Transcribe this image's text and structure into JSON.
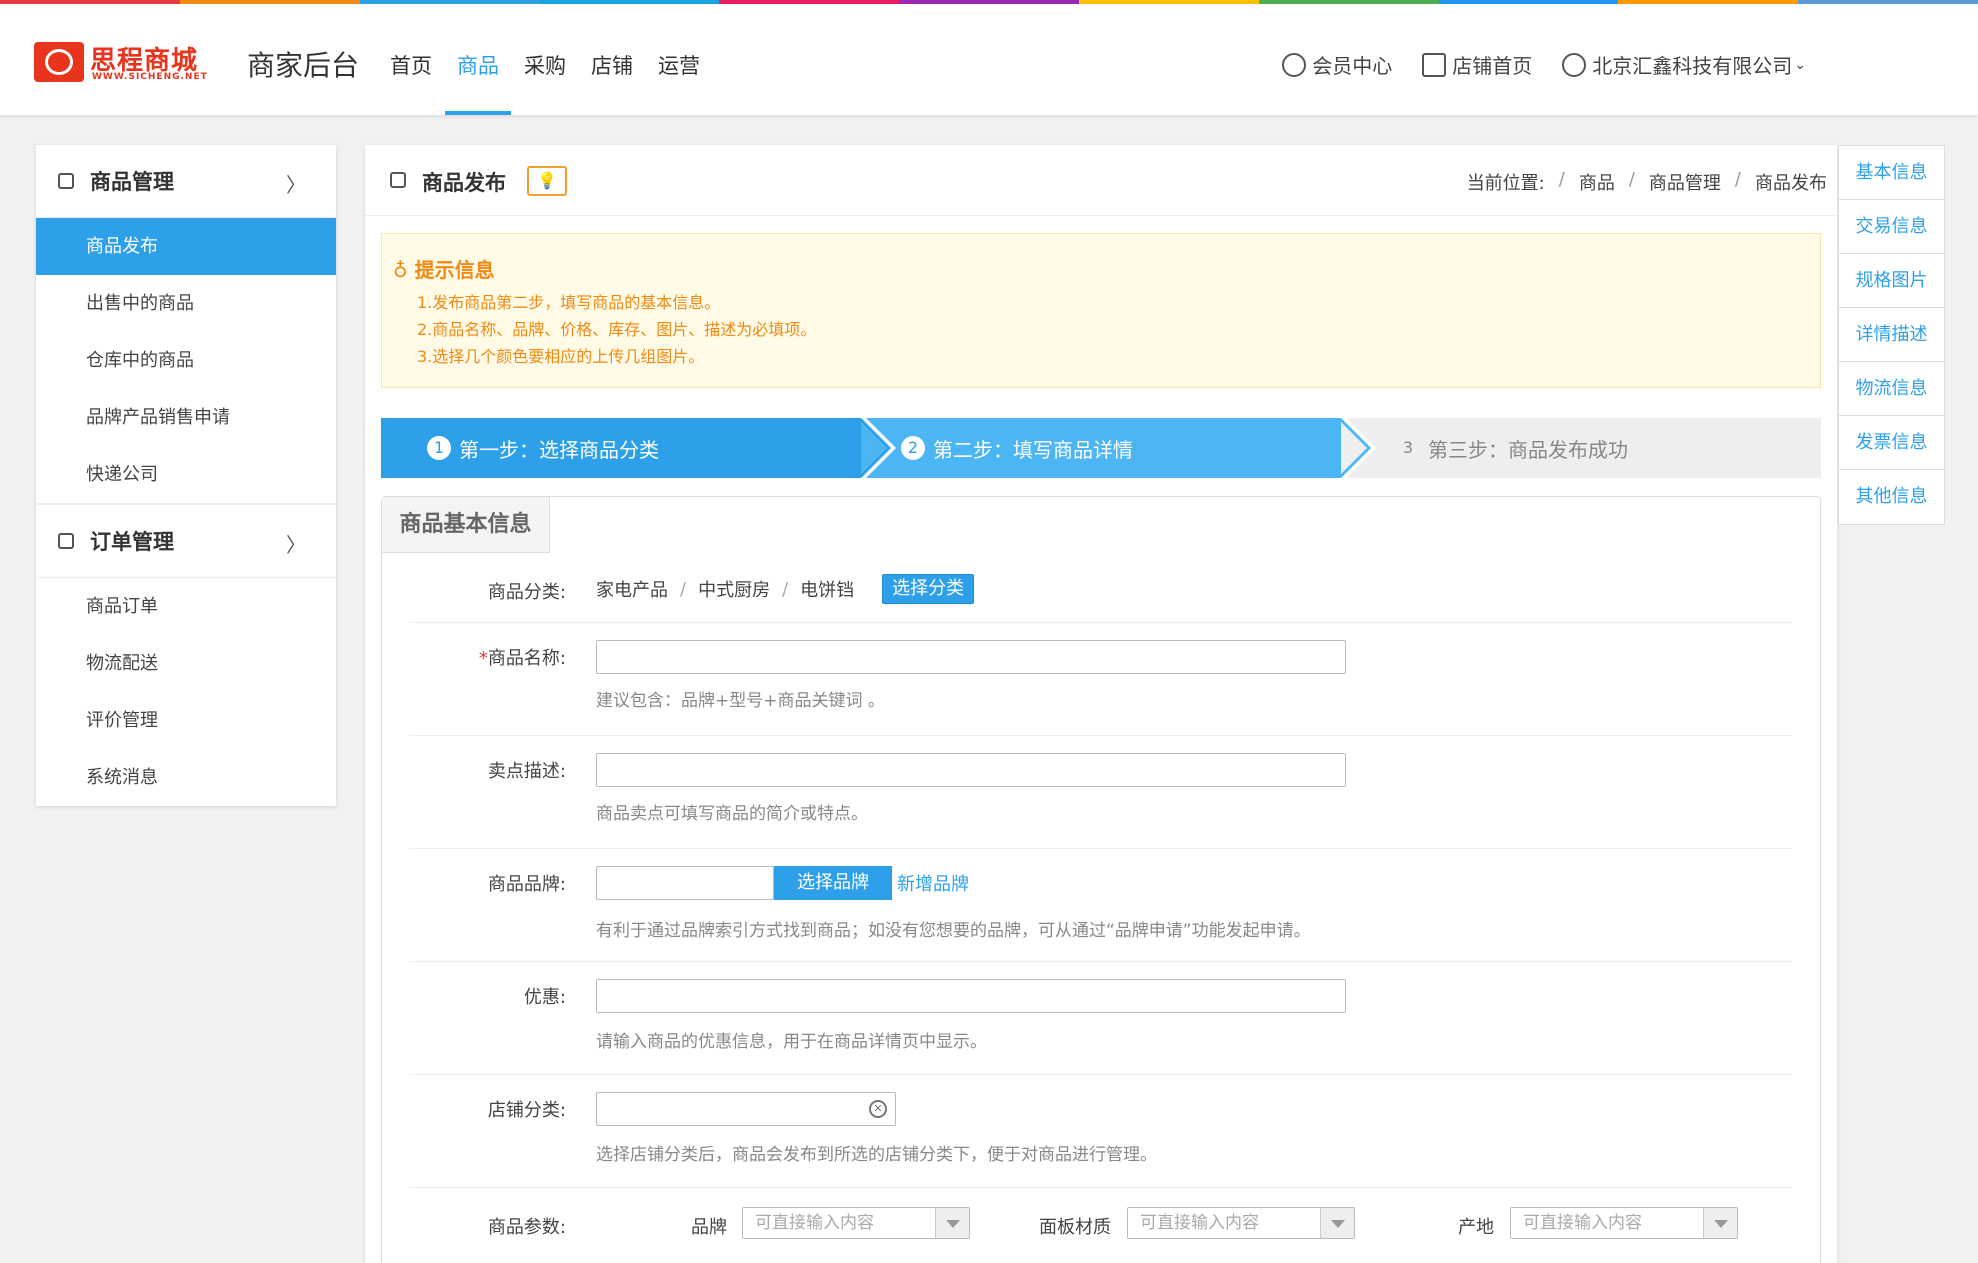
{
  "colors": {
    "accent": "#2ea0ea",
    "step2": "#4cb6f4",
    "tip": "#f08a14",
    "stripe": [
      "#e4393c",
      "#f08a14",
      "#2ea0ea",
      "#1aa1e4",
      "#e91e63",
      "#9c27b0",
      "#ffc107",
      "#4caf50",
      "#2196f3",
      "#ff9800",
      "#5b9bd5"
    ]
  },
  "header": {
    "logo_text": "思程商城",
    "logo_sub": "WWW.SICHENG.NET",
    "title": "商家后台",
    "nav": [
      "首页",
      "商品",
      "采购",
      "店铺",
      "运营"
    ],
    "nav_active": "商品",
    "member_center": "会员中心",
    "store_home": "店铺首页",
    "company": "北京汇鑫科技有限公司"
  },
  "sidebar": {
    "groups": [
      {
        "title": "商品管理",
        "items": [
          "商品发布",
          "出售中的商品",
          "仓库中的商品",
          "品牌产品销售申请",
          "快递公司"
        ],
        "active": "商品发布"
      },
      {
        "title": "订单管理",
        "items": [
          "商品订单",
          "物流配送",
          "评价管理",
          "系统消息"
        ]
      }
    ]
  },
  "page": {
    "title": "商品发布",
    "breadcrumb_label": "当前位置:",
    "breadcrumb": [
      "商品",
      "商品管理",
      "商品发布"
    ]
  },
  "tips": {
    "title": "提示信息",
    "lines": [
      "1.发布商品第二步，填写商品的基本信息。",
      "2.商品名称、品牌、价格、库存、图片、描述为必填项。",
      "3.选择几个颜色要相应的上传几组图片。"
    ]
  },
  "steps": [
    {
      "num": "1",
      "label": "第一步：选择商品分类"
    },
    {
      "num": "2",
      "label": "第二步：填写商品详情"
    },
    {
      "num": "3",
      "label": "第三步：商品发布成功"
    }
  ],
  "form": {
    "section_title": "商品基本信息",
    "category": {
      "label": "商品分类:",
      "path": [
        "家电产品",
        "中式厨房",
        "电饼铛"
      ],
      "button": "选择分类"
    },
    "name": {
      "required_mark": "*",
      "label": "商品名称:",
      "value": "",
      "hint": "建议包含：品牌+型号+商品关键词 。"
    },
    "selling_point": {
      "label": "卖点描述:",
      "value": "",
      "hint": "商品卖点可填写商品的简介或特点。"
    },
    "brand": {
      "label": "商品品牌:",
      "value": "",
      "button": "选择品牌",
      "link": "新增品牌",
      "hint": "有利于通过品牌索引方式找到商品；如没有您想要的品牌，可从通过“品牌申请”功能发起申请。"
    },
    "discount": {
      "label": "优惠:",
      "value": "",
      "hint": "请输入商品的优惠信息，用于在商品详情页中显示。"
    },
    "store_category": {
      "label": "店铺分类:",
      "value": "",
      "hint": "选择店铺分类后，商品会发布到所选的店铺分类下，便于对商品进行管理。"
    },
    "params": {
      "label": "商品参数:",
      "fields": [
        {
          "name": "品牌",
          "placeholder": "可直接输入内容"
        },
        {
          "name": "面板材质",
          "placeholder": "可直接输入内容"
        },
        {
          "name": "产地",
          "placeholder": "可直接输入内容"
        }
      ]
    }
  },
  "right_nav": [
    "基本信息",
    "交易信息",
    "规格图片",
    "详情描述",
    "物流信息",
    "发票信息",
    "其他信息"
  ]
}
